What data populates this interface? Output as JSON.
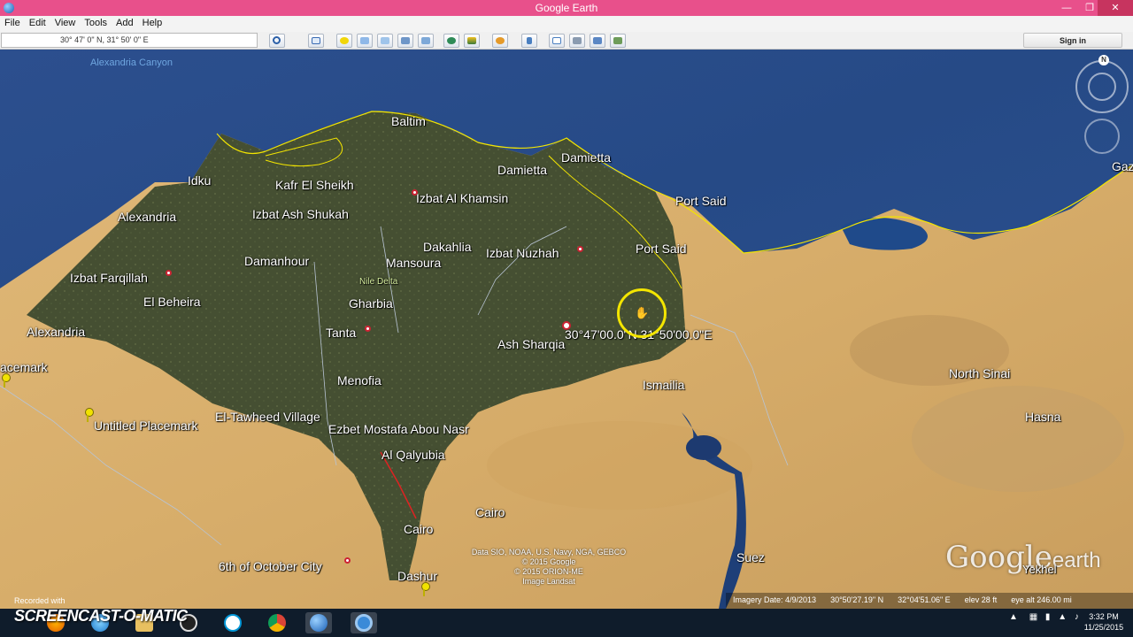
{
  "window": {
    "title": "Google Earth"
  },
  "menu": [
    "File",
    "Edit",
    "View",
    "Tools",
    "Add",
    "Help"
  ],
  "toolbar": {
    "coordinates": "30° 47' 0\" N, 31° 50' 0\" E",
    "signin_label": "Sign in"
  },
  "map": {
    "sea_label": "Alexandria Canyon",
    "places": [
      "Baltim",
      "Idku",
      "Kafr El Sheikh",
      "Izbat Ash Shukah",
      "Alexandria",
      "Damietta",
      "Damietta",
      "Izbat Al Khamsin",
      "Port Said",
      "Port Said",
      "Dakahlia",
      "Izbat Nuzhah",
      "Mansoura",
      "Damanhour",
      "Izbat Farqillah",
      "El Beheira",
      "Gharbia",
      "Tanta",
      "Alexandria",
      "Ash Sharqia",
      "Menofia",
      "Ismailia",
      "El-Tawheed Village",
      "Ezbet Mostafa Abou Nasr",
      "Al Qalyubia",
      "Cairo",
      "Cairo",
      "6th of October City",
      "Dashur",
      "Suez",
      "North Sinai",
      "Hasna",
      "Gaz",
      "acemark",
      "Untitled Placemark"
    ],
    "small_label": "Nile Delta",
    "pointer_label": "30°47'00.0\"N 31°50'00.0\"E",
    "credits": [
      "Data SIO, NOAA, U.S. Navy, NGA, GEBCO",
      "© 2015 Google",
      "© 2015 ORION-ME",
      "Image Landsat"
    ],
    "brand": "Google",
    "brand_suffix": "earth",
    "brand_extra": "Yekhel",
    "status": {
      "imagery_date": "Imagery Date: 4/9/2013",
      "lat": "30°50'27.19\" N",
      "lon": "32°04'51.06\" E",
      "elev": "elev   28 ft",
      "eye_alt": "eye alt 246.00 mi"
    },
    "compass_n": "N"
  },
  "recorder": {
    "recorded_with": "Recorded with",
    "brand": "SCREENCAST-O-MATIC"
  },
  "taskbar": {
    "time": "3:32 PM",
    "date": "11/25/2015"
  },
  "colors": {
    "titlebar": "#e8508b",
    "sea": "#2c4f8e",
    "delta": "#3e4a2e",
    "desert": "#d9b270",
    "border": "#f3e500"
  }
}
